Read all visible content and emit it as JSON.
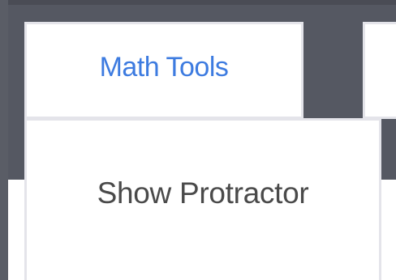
{
  "toolbar": {
    "tabs": [
      {
        "label": "Math Tools",
        "active": true
      },
      {
        "label": "",
        "active": false
      }
    ]
  },
  "dropdown": {
    "items": [
      {
        "label": "Show Protractor"
      }
    ]
  },
  "colors": {
    "toolbar_bg": "#555862",
    "tab_label": "#3d7be0",
    "menu_text": "#4a4a4a",
    "border": "#e4e4ea"
  }
}
